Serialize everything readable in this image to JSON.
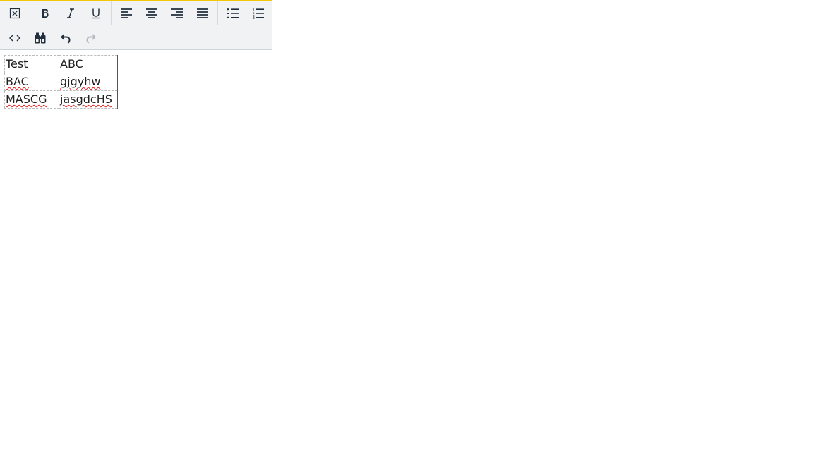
{
  "toolbar": {
    "row1": [
      {
        "name": "remove-format-button",
        "icon": "remove-format-icon"
      },
      {
        "name": "bold-button",
        "icon": "bold-icon"
      },
      {
        "name": "italic-button",
        "icon": "italic-icon"
      },
      {
        "name": "underline-button",
        "icon": "underline-icon"
      },
      {
        "name": "align-left-button",
        "icon": "align-left-icon"
      },
      {
        "name": "align-center-button",
        "icon": "align-center-icon"
      },
      {
        "name": "align-right-button",
        "icon": "align-right-icon"
      },
      {
        "name": "align-justify-button",
        "icon": "align-justify-icon"
      },
      {
        "name": "bullet-list-button",
        "icon": "bullet-list-icon"
      },
      {
        "name": "numbered-list-button",
        "icon": "numbered-list-icon"
      }
    ],
    "row2": [
      {
        "name": "source-code-button",
        "icon": "code-icon"
      },
      {
        "name": "find-replace-button",
        "icon": "binoculars-icon"
      },
      {
        "name": "undo-button",
        "icon": "undo-icon"
      },
      {
        "name": "redo-button",
        "icon": "redo-icon",
        "disabled": true
      }
    ],
    "accent_color": "#f2c80a"
  },
  "table": {
    "rows": [
      [
        "Test",
        "ABC"
      ],
      [
        "BAC",
        "gjgyhw"
      ],
      [
        "MASCG",
        "jasgdcHS"
      ]
    ]
  }
}
